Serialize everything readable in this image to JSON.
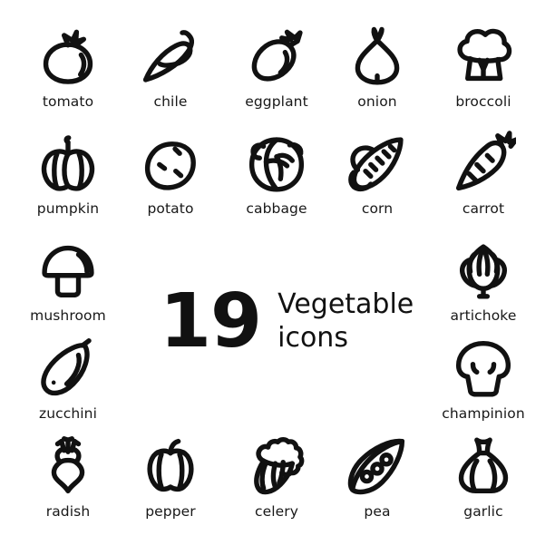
{
  "poster": {
    "background_color": "#ffffff",
    "stroke_color": "#111111",
    "text_color": "#181818"
  },
  "center": {
    "count": "19",
    "title_line1": "Vegetable",
    "title_line2": "icons"
  },
  "grid": {
    "rows": [
      {
        "row": 1,
        "items": [
          {
            "icon": "tomato-icon",
            "label": "tomato"
          },
          {
            "icon": "chile-icon",
            "label": "chile"
          },
          {
            "icon": "eggplant-icon",
            "label": "eggplant"
          },
          {
            "icon": "onion-icon",
            "label": "onion"
          },
          {
            "icon": "broccoli-icon",
            "label": "broccoli"
          }
        ]
      },
      {
        "row": 2,
        "items": [
          {
            "icon": "pumpkin-icon",
            "label": "pumpkin"
          },
          {
            "icon": "potato-icon",
            "label": "potato"
          },
          {
            "icon": "cabbage-icon",
            "label": "cabbage"
          },
          {
            "icon": "corn-icon",
            "label": "corn"
          },
          {
            "icon": "carrot-icon",
            "label": "carrot"
          }
        ]
      },
      {
        "row": 3,
        "items": [
          {
            "icon": "mushroom-icon",
            "label": "mushroom"
          },
          {
            "icon": "artichoke-icon",
            "label": "artichoke"
          }
        ]
      },
      {
        "row": 4,
        "items": [
          {
            "icon": "zucchini-icon",
            "label": "zucchini"
          },
          {
            "icon": "champinion-icon",
            "label": "champinion"
          }
        ]
      },
      {
        "row": 5,
        "items": [
          {
            "icon": "radish-icon",
            "label": "radish"
          },
          {
            "icon": "pepper-icon",
            "label": "pepper"
          },
          {
            "icon": "celery-icon",
            "label": "celery"
          },
          {
            "icon": "pea-icon",
            "label": "pea"
          },
          {
            "icon": "garlic-icon",
            "label": "garlic"
          }
        ]
      }
    ]
  }
}
